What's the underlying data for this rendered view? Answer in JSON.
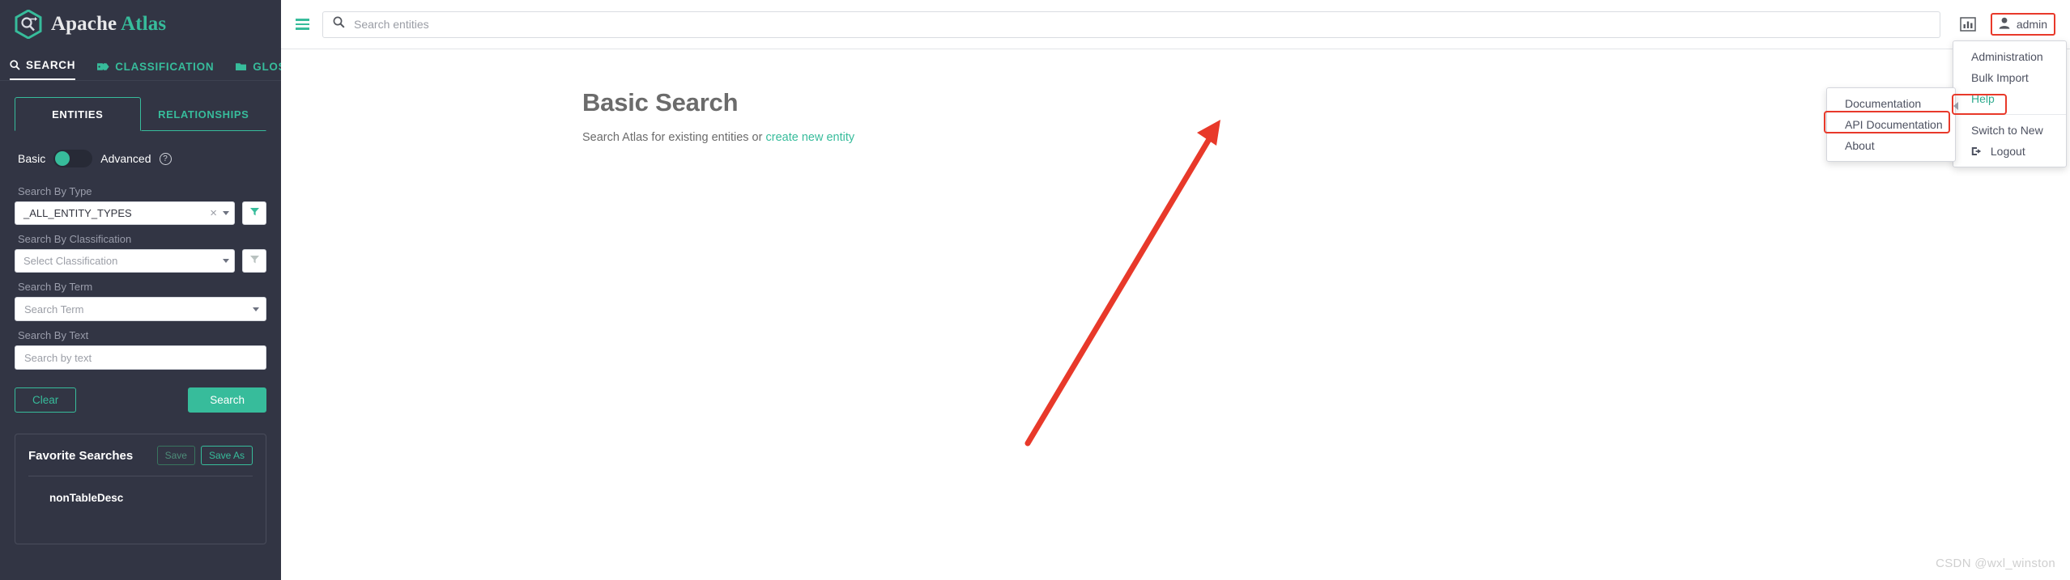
{
  "brand": {
    "word1": "Apache",
    "word2": "Atlas"
  },
  "nav_tabs": [
    {
      "label": "SEARCH",
      "icon": "search-icon",
      "active": true
    },
    {
      "label": "CLASSIFICATION",
      "icon": "tag-icon",
      "active": false
    },
    {
      "label": "GLOSSARY",
      "icon": "book-icon",
      "active": false
    }
  ],
  "sub_tabs": [
    {
      "label": "ENTITIES",
      "active": true
    },
    {
      "label": "RELATIONSHIPS",
      "active": false
    }
  ],
  "toggle": {
    "basic_label": "Basic",
    "advanced_label": "Advanced",
    "help_glyph": "?"
  },
  "search_form": {
    "type": {
      "label": "Search By Type",
      "value": "_ALL_ENTITY_TYPES",
      "clear_glyph": "×",
      "filter_icon": "funnel-icon"
    },
    "classification": {
      "label": "Search By Classification",
      "placeholder": "Select Classification",
      "filter_icon": "funnel-icon"
    },
    "term": {
      "label": "Search By Term",
      "placeholder": "Search Term"
    },
    "text": {
      "label": "Search By Text",
      "placeholder": "Search by text"
    },
    "clear_button": "Clear",
    "search_button": "Search"
  },
  "favorites": {
    "title": "Favorite Searches",
    "save_label": "Save",
    "save_as_label": "Save As",
    "items": [
      "nonTableDesc"
    ]
  },
  "topbar": {
    "menu_icon": "hamburger-icon",
    "search_placeholder": "Search entities",
    "search_icon": "search-icon",
    "stats_icon": "bar-chart-icon",
    "user_icon": "user-icon",
    "user_label": "admin"
  },
  "page": {
    "title": "Basic Search",
    "subtitle_prefix": "Search Atlas for existing entities or ",
    "subtitle_link": "create new entity"
  },
  "user_menu": {
    "items": [
      {
        "label": "Administration",
        "icon": null,
        "highlight": false
      },
      {
        "label": "Bulk Import",
        "icon": null,
        "highlight": false
      },
      {
        "label": "Help",
        "icon": null,
        "highlight": true
      },
      {
        "separator": true
      },
      {
        "label": "Switch to New",
        "icon": null,
        "highlight": false
      },
      {
        "label": "Logout",
        "icon": "logout-icon",
        "highlight": false
      }
    ]
  },
  "help_menu": {
    "items": [
      {
        "label": "Documentation",
        "highlight": false
      },
      {
        "label": "API Documentation",
        "highlight": true
      },
      {
        "label": "About",
        "highlight": false
      }
    ]
  },
  "colors": {
    "accent": "#37bc9b",
    "sidebar_bg": "#323544",
    "highlight": "#e8392a",
    "annotation_arrow": "#e8392a"
  },
  "watermark": "CSDN @wxl_winston"
}
